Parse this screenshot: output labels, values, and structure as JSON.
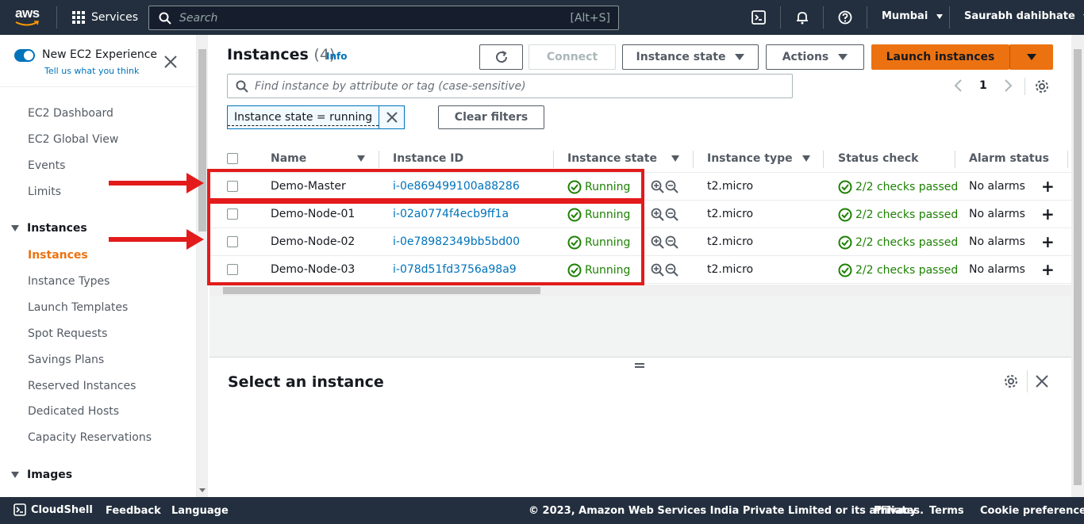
{
  "topnav": {
    "logo": "aws",
    "services": "Services",
    "search_placeholder": "Search",
    "search_shortcut": "[Alt+S]",
    "region": "Mumbai",
    "user": "Saurabh dahibhate"
  },
  "sidebar": {
    "new_experience": "New EC2 Experience",
    "tell_us": "Tell us what you think",
    "top_items": [
      "EC2 Dashboard",
      "EC2 Global View",
      "Events",
      "Limits"
    ],
    "instances_section": "Instances",
    "instances_items": [
      "Instances",
      "Instance Types",
      "Launch Templates",
      "Spot Requests",
      "Savings Plans",
      "Reserved Instances",
      "Dedicated Hosts",
      "Capacity Reservations"
    ],
    "images_section": "Images"
  },
  "header": {
    "title": "Instances",
    "count": "(4)",
    "info": "Info",
    "connect": "Connect",
    "instance_state": "Instance state",
    "actions": "Actions",
    "launch": "Launch instances",
    "filter_placeholder": "Find instance by attribute or tag (case-sensitive)",
    "page": "1",
    "filter_token": "Instance state = running",
    "clear_filters": "Clear filters"
  },
  "table": {
    "columns": [
      "Name",
      "Instance ID",
      "Instance state",
      "Instance type",
      "Status check",
      "Alarm status"
    ],
    "rows": [
      {
        "name": "Demo-Master",
        "id": "i-0e869499100a88286",
        "state": "Running",
        "type": "t2.micro",
        "status": "2/2 checks passed",
        "alarm": "No alarms"
      },
      {
        "name": "Demo-Node-01",
        "id": "i-02a0774f4ecb9ff1a",
        "state": "Running",
        "type": "t2.micro",
        "status": "2/2 checks passed",
        "alarm": "No alarms"
      },
      {
        "name": "Demo-Node-02",
        "id": "i-0e78982349bb5bd00",
        "state": "Running",
        "type": "t2.micro",
        "status": "2/2 checks passed",
        "alarm": "No alarms"
      },
      {
        "name": "Demo-Node-03",
        "id": "i-078d51fd3756a98a9",
        "state": "Running",
        "type": "t2.micro",
        "status": "2/2 checks passed",
        "alarm": "No alarms"
      }
    ]
  },
  "split_panel": {
    "title": "Select an instance"
  },
  "footer": {
    "cloudshell": "CloudShell",
    "feedback": "Feedback",
    "language": "Language",
    "copyright": "© 2023, Amazon Web Services India Private Limited or its affiliates.",
    "privacy": "Privacy",
    "terms": "Terms",
    "cookies": "Cookie preferences"
  },
  "colors": {
    "nav_bg": "#232f3e",
    "accent_orange": "#ec7211",
    "link_blue": "#0073bb",
    "success_green": "#1d8102",
    "annotation_red": "#e31b1b"
  }
}
